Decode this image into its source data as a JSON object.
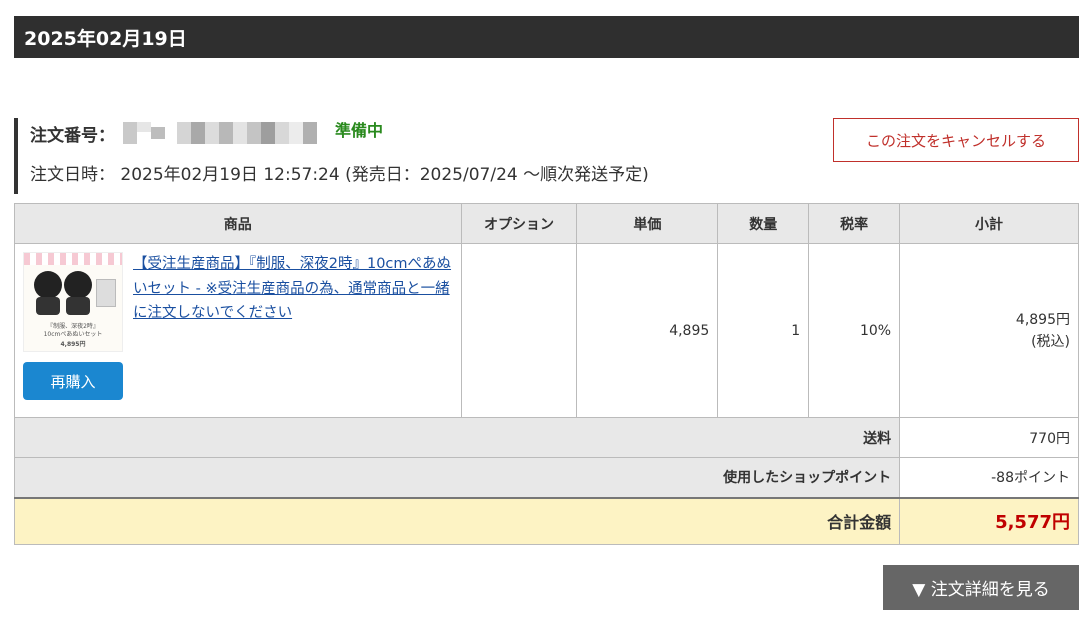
{
  "header": {
    "date": "2025年02月19日"
  },
  "order": {
    "number_label": "注文番号：",
    "status": "準備中",
    "datetime_text": "注文日時： 2025年02月19日 12:57:24 (発売日：2025/07/24 ～順次発送予定)",
    "cancel_label": "この注文をキャンセルする"
  },
  "table": {
    "headers": [
      "商品",
      "オプション",
      "単価",
      "数量",
      "税率",
      "小計"
    ],
    "item": {
      "name": "【受注生産商品】『制服、深夜2時』10cmぺあぬいセット - ※受注生産商品の為、通常商品と一緒に注文しないでください",
      "thumb_text_1": "『制服、深夜2時』",
      "thumb_text_2": "10cmぺあぬいセット",
      "thumb_price": "4,895円",
      "rebuy_label": "再購入",
      "option": "",
      "unit_price": "4,895",
      "quantity": "1",
      "tax_rate": "10%",
      "subtotal": "4,895円",
      "subtotal_note": "(税込)"
    },
    "shipping_label": "送料",
    "shipping_value": "770円",
    "points_label": "使用したショップポイント",
    "points_value": "-88ポイント",
    "total_label": "合計金額",
    "total_value": "5,577円"
  },
  "detail_button": "▼ 注文詳細を見る",
  "colors": {
    "header_bg": "#2f2f2f",
    "status_green": "#2a8a1e",
    "cancel_red": "#c0302b",
    "link_blue": "#1a4fa0",
    "rebuy_blue": "#1b87d0",
    "total_red": "#c00000",
    "total_bg": "#fdf3c4"
  }
}
